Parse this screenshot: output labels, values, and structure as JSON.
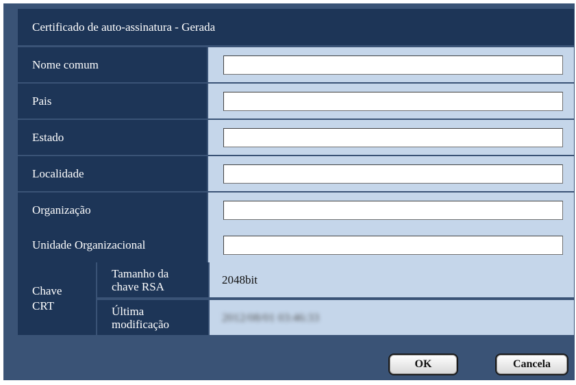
{
  "dialog": {
    "title": "Certificado de auto-assinatura - Gerada"
  },
  "fields": [
    {
      "label": "Nome comum",
      "value": ""
    },
    {
      "label": "Pais",
      "value": ""
    },
    {
      "label": "Estado",
      "value": ""
    },
    {
      "label": "Localidade",
      "value": ""
    },
    {
      "label": "Organização",
      "value": ""
    },
    {
      "label": "Unidade Organizacional",
      "value": ""
    }
  ],
  "crt": {
    "label_line1": "Chave",
    "label_line2": "CRT",
    "rsa_size_label_line1": "Tamanho da",
    "rsa_size_label_line2": "chave RSA",
    "rsa_size_value": "2048bit",
    "last_modified_label_line1": "Última",
    "last_modified_label_line2": "modificação",
    "last_modified_value": "2012/08/01 03:46:33"
  },
  "buttons": {
    "ok_label": "OK",
    "cancel_label": "Cancela"
  }
}
